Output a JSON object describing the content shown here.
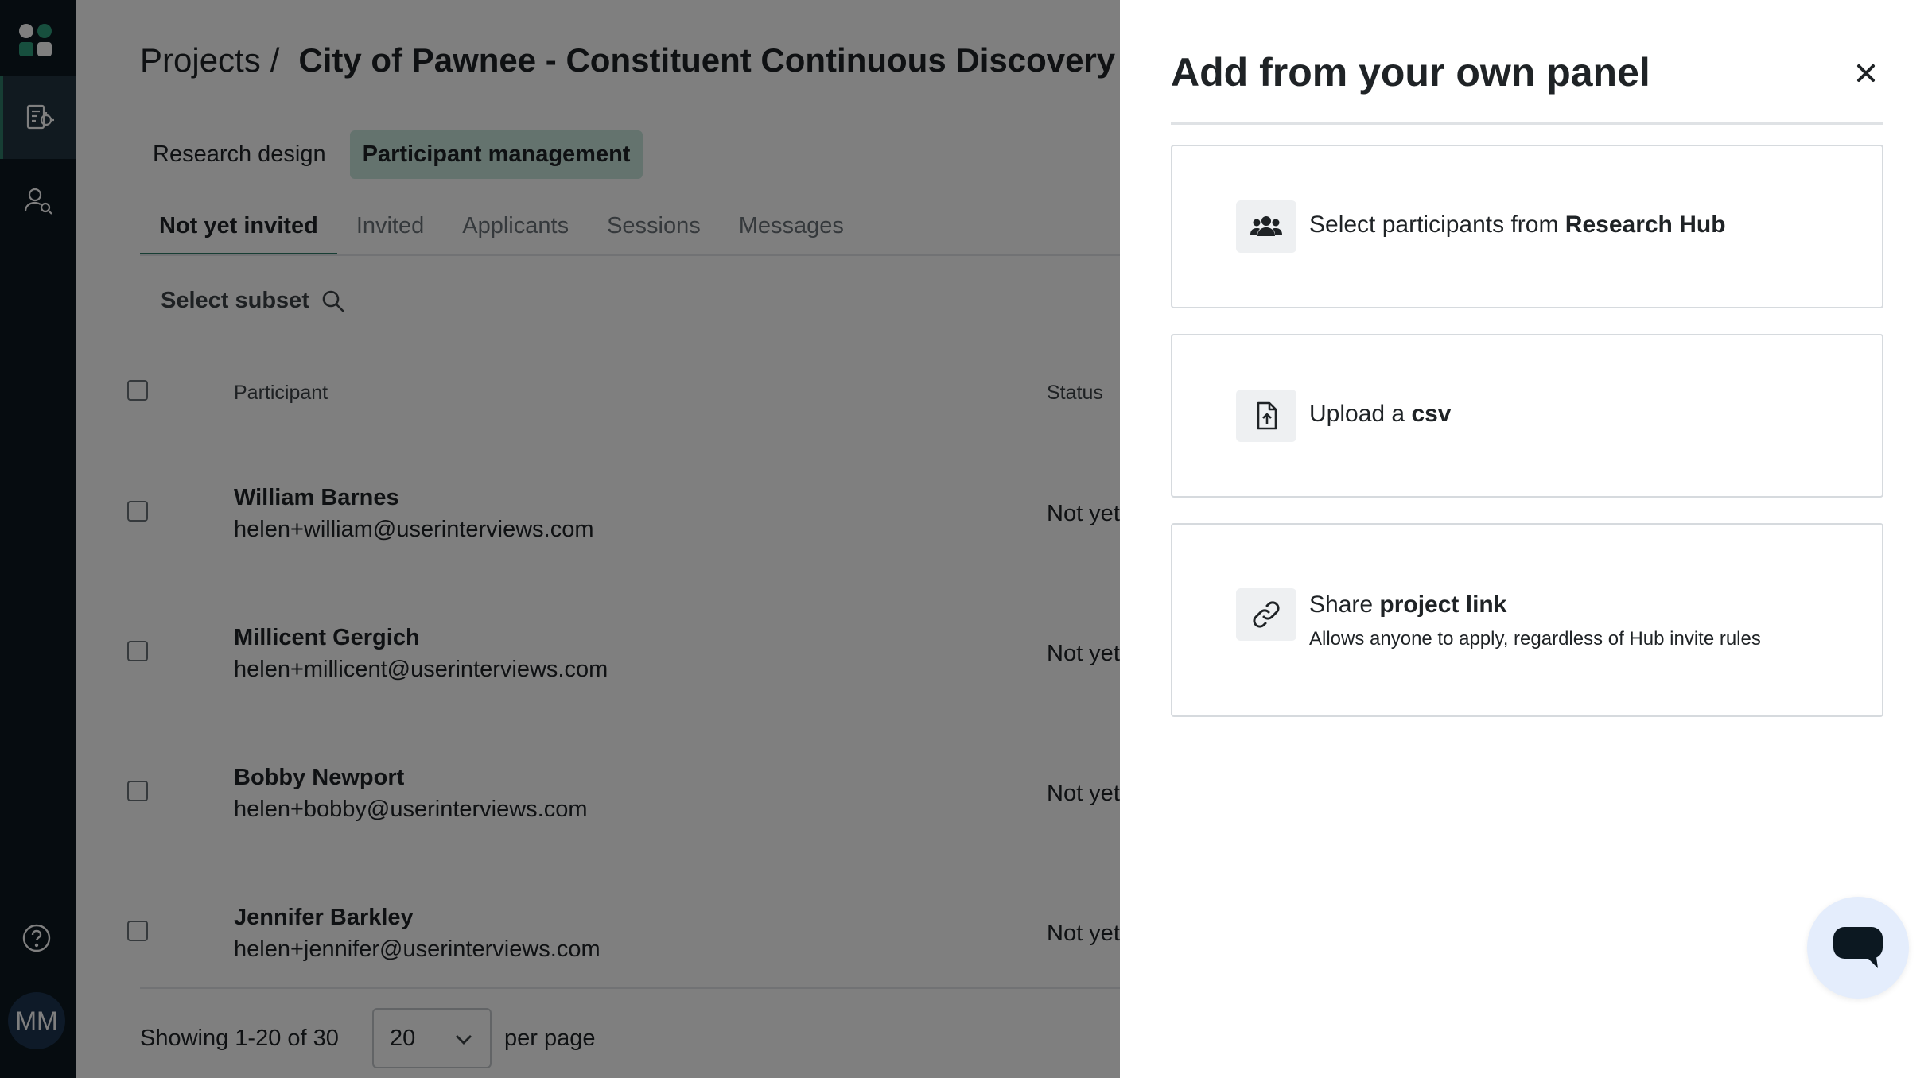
{
  "sidebar": {
    "avatar_initials": "MM",
    "accent_color": "#2f7d69"
  },
  "breadcrumb": {
    "parent": "Projects",
    "separator": "/",
    "title": "City of Pawnee - Constituent Continuous Discovery"
  },
  "top_tabs": [
    {
      "label": "Research design",
      "active": false
    },
    {
      "label": "Participant management",
      "active": true
    }
  ],
  "sub_tabs": [
    {
      "label": "Not yet invited",
      "active": true
    },
    {
      "label": "Invited",
      "active": false
    },
    {
      "label": "Applicants",
      "active": false
    },
    {
      "label": "Sessions",
      "active": false
    },
    {
      "label": "Messages",
      "active": false
    }
  ],
  "subset": {
    "label": "Select subset"
  },
  "table": {
    "headers": {
      "participant": "Participant",
      "status": "Status"
    },
    "rows": [
      {
        "name": "William Barnes",
        "email": "helen+william@userinterviews.com",
        "status": "Not yet"
      },
      {
        "name": "Millicent Gergich",
        "email": "helen+millicent@userinterviews.com",
        "status": "Not yet"
      },
      {
        "name": "Bobby Newport",
        "email": "helen+bobby@userinterviews.com",
        "status": "Not yet"
      },
      {
        "name": "Jennifer Barkley",
        "email": "helen+jennifer@userinterviews.com",
        "status": "Not yet"
      }
    ]
  },
  "pagination": {
    "showing": "Showing 1-20 of 30",
    "per_page_value": "20",
    "per_page_label": "per page"
  },
  "drawer": {
    "title": "Add from your own panel",
    "options": [
      {
        "icon": "users-icon",
        "text_prefix": "Select participants from ",
        "text_bold": "Research Hub"
      },
      {
        "icon": "file-upload-icon",
        "text_prefix": "Upload a ",
        "text_bold": "csv"
      },
      {
        "icon": "link-icon",
        "text_prefix": "Share ",
        "text_bold": "project link",
        "subtext": "Allows anyone to apply, regardless of Hub invite rules"
      }
    ]
  }
}
